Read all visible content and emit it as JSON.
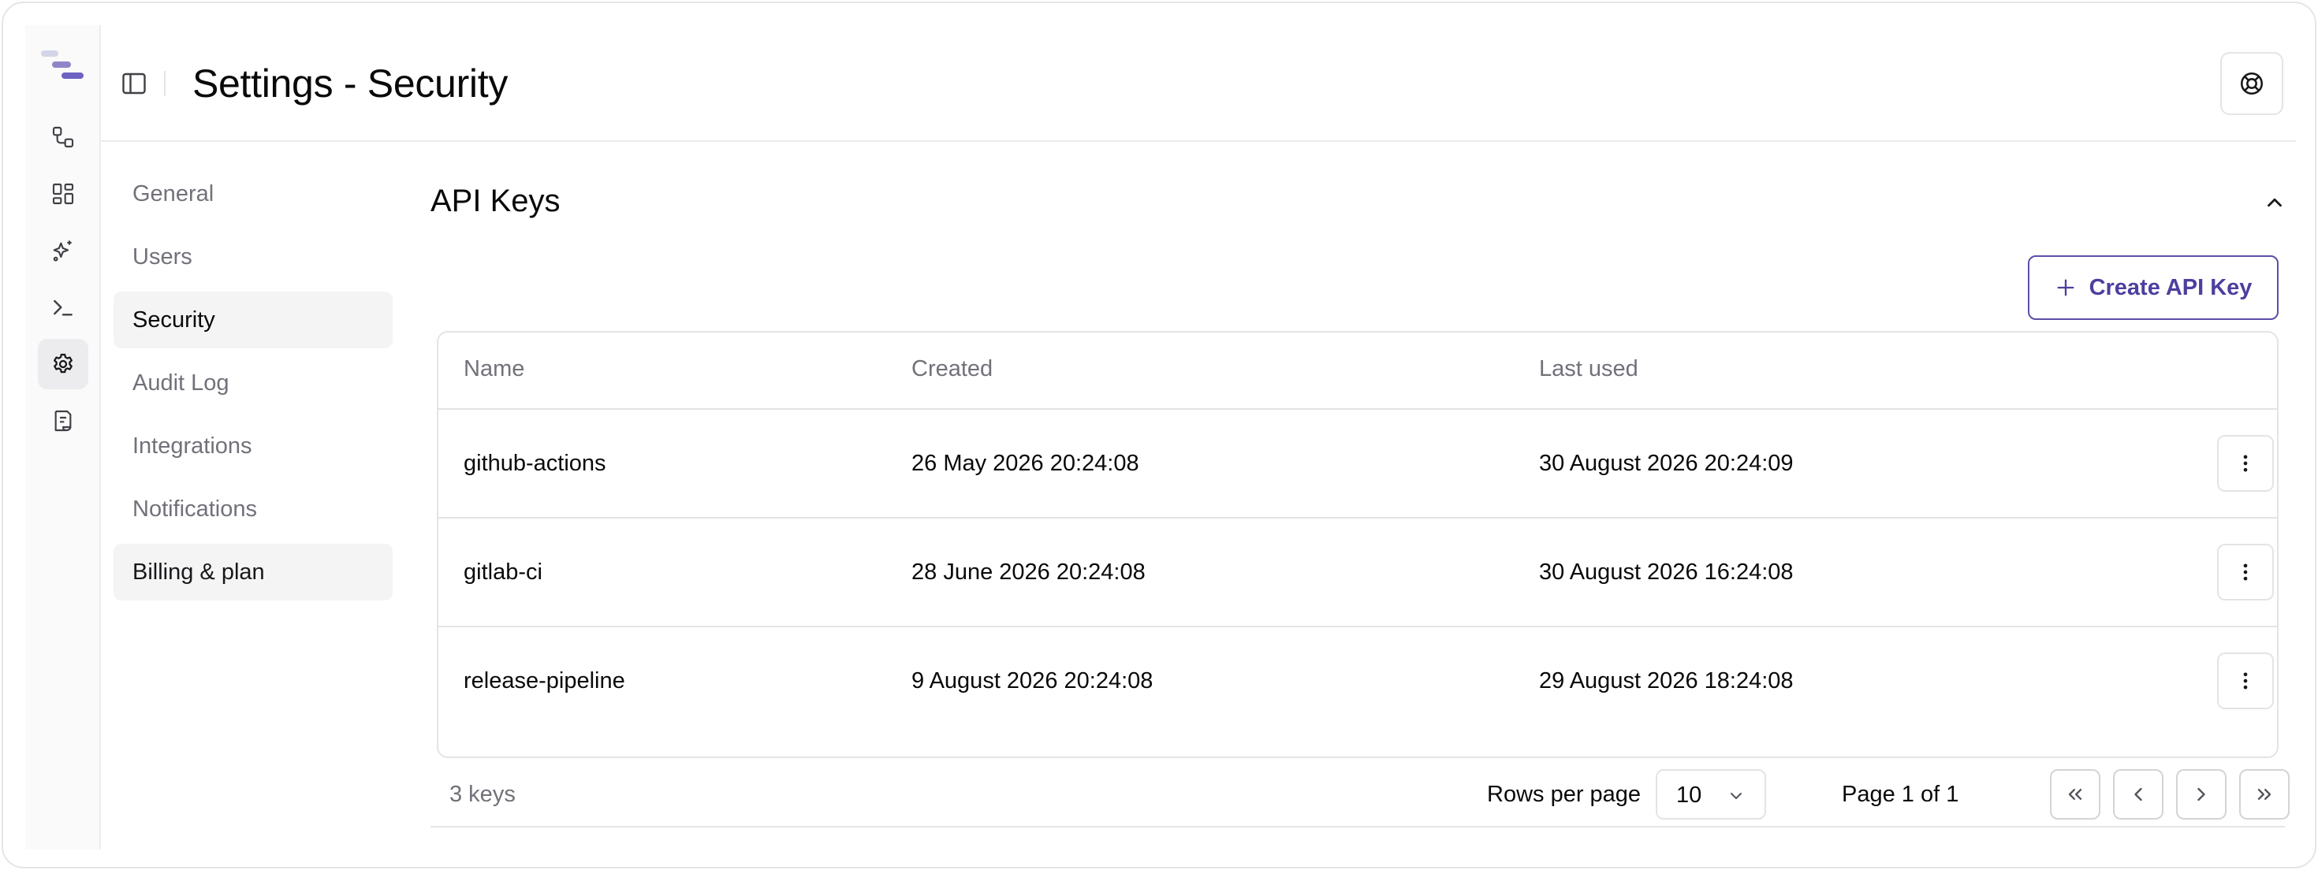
{
  "header": {
    "title": "Settings - Security"
  },
  "rail": {
    "items": [
      {
        "icon": "workflow-icon"
      },
      {
        "icon": "dashboard-icon"
      },
      {
        "icon": "sparkles-icon"
      },
      {
        "icon": "terminal-icon"
      },
      {
        "icon": "gear-icon",
        "active": true
      },
      {
        "icon": "document-icon"
      }
    ]
  },
  "settings_nav": {
    "items": [
      {
        "label": "General"
      },
      {
        "label": "Users"
      },
      {
        "label": "Security",
        "active": true
      },
      {
        "label": "Audit Log"
      },
      {
        "label": "Integrations"
      },
      {
        "label": "Notifications"
      },
      {
        "label": "Billing & plan"
      }
    ]
  },
  "api_keys": {
    "section_title": "API Keys",
    "create_label": "Create API Key",
    "columns": [
      "Name",
      "Created",
      "Last used"
    ],
    "rows": [
      {
        "name": "github-actions",
        "created": "26 May 2026 20:24:08",
        "last_used": "30 August 2026 20:24:09"
      },
      {
        "name": "gitlab-ci",
        "created": "28 June 2026 20:24:08",
        "last_used": "30 August 2026 16:24:08"
      },
      {
        "name": "release-pipeline",
        "created": "9 August 2026 20:24:08",
        "last_used": "29 August 2026 18:24:08"
      }
    ]
  },
  "pagination": {
    "count_label": "3 keys",
    "rows_per_page_label": "Rows per page",
    "rows_per_page_value": "10",
    "page_label": "Page 1 of 1"
  },
  "colors": {
    "accent": "#5b4fa8",
    "active_bg": "#f4f4f5",
    "border": "#e4e4e7",
    "muted_text": "#71717a"
  }
}
